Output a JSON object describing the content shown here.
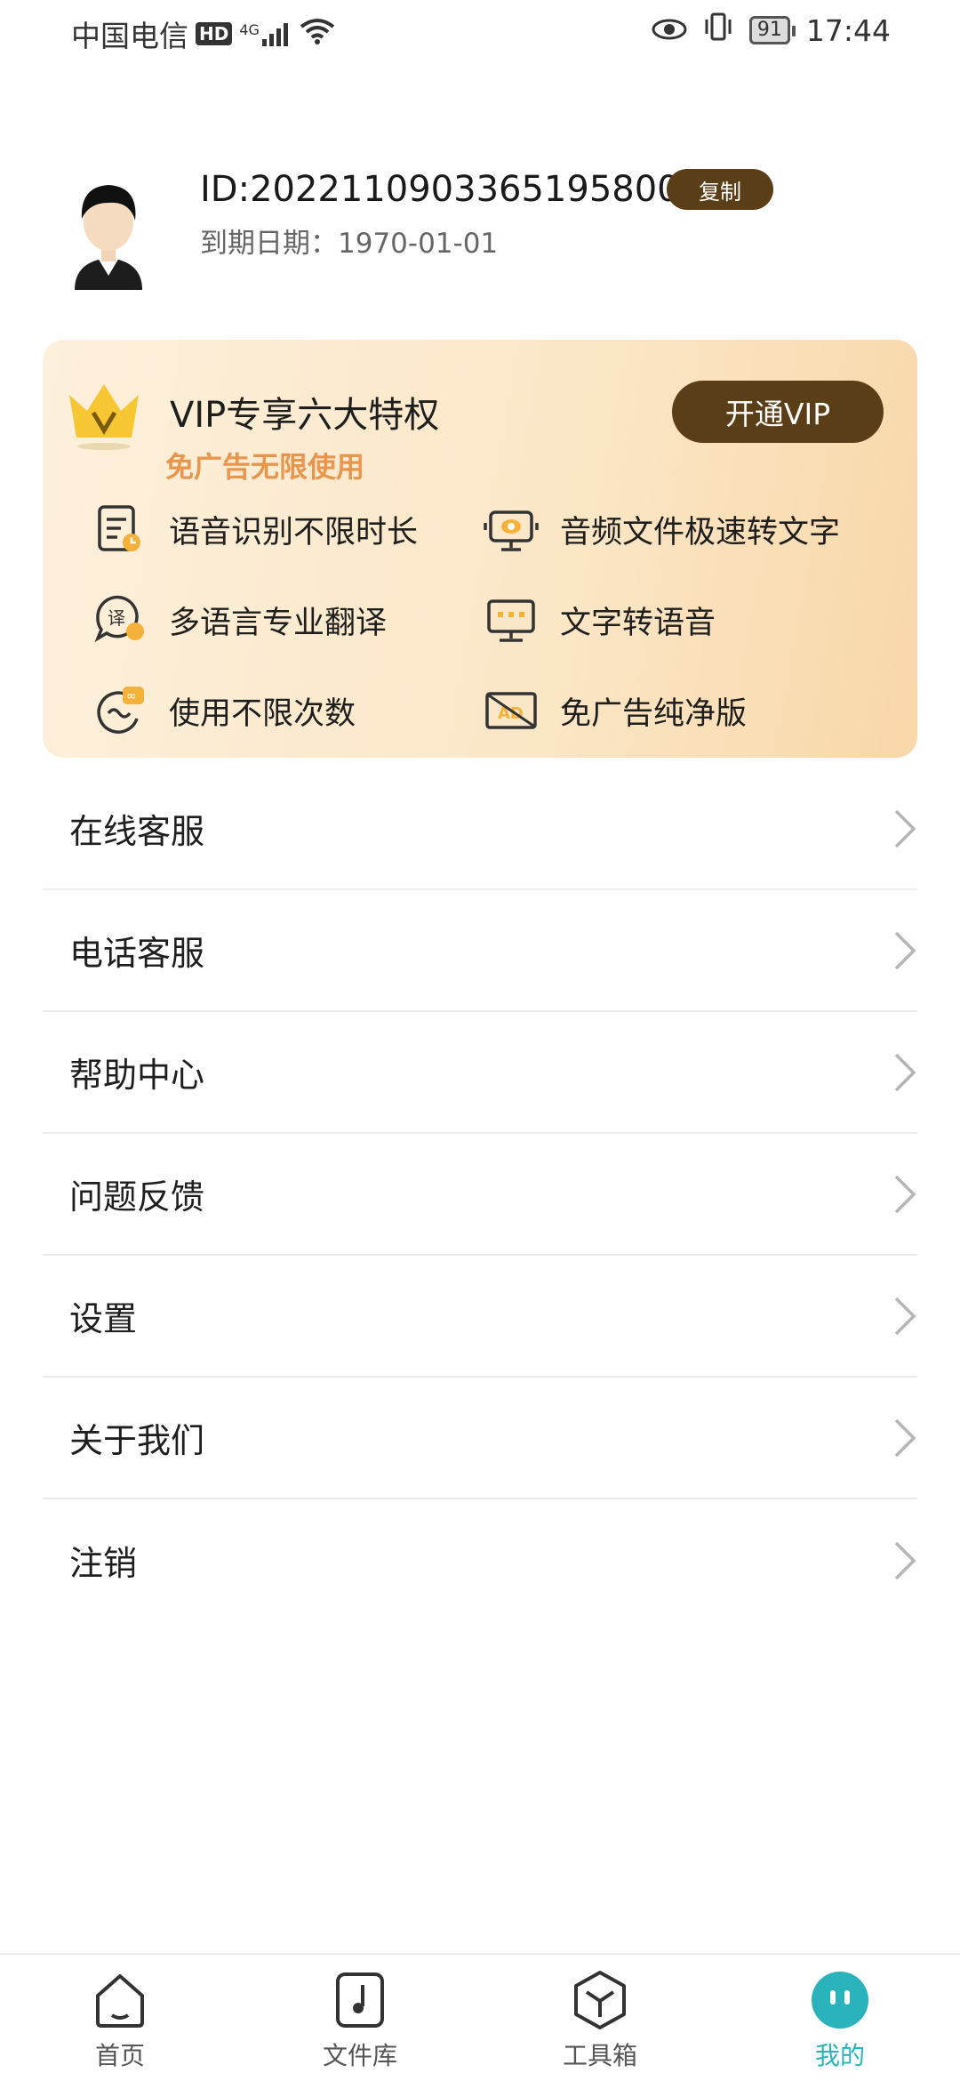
{
  "status_bar": {
    "carrier": "中国电信",
    "hd": "HD",
    "network": "4G",
    "battery": "91",
    "time": "17:44"
  },
  "profile": {
    "id": "ID:2022110903365195800",
    "copy_label": "复制",
    "expire": "到期日期：1970-01-01"
  },
  "vip": {
    "title": "VIP专享六大特权",
    "subtitle": "免广告无限使用",
    "button": "开通VIP",
    "features": [
      {
        "label": "语音识别不限时长",
        "icon": "voice-record-icon"
      },
      {
        "label": "音频文件极速转文字",
        "icon": "audio-to-text-icon"
      },
      {
        "label": "多语言专业翻译",
        "icon": "translate-icon"
      },
      {
        "label": "文字转语音",
        "icon": "text-to-speech-icon"
      },
      {
        "label": "使用不限次数",
        "icon": "unlimited-icon"
      },
      {
        "label": "免广告纯净版",
        "icon": "no-ads-icon"
      }
    ],
    "colors": {
      "accent": "#5a3e18",
      "subtitle": "#e9964c"
    }
  },
  "menu": [
    {
      "label": "在线客服"
    },
    {
      "label": "电话客服"
    },
    {
      "label": "帮助中心"
    },
    {
      "label": "问题反馈"
    },
    {
      "label": "设置"
    },
    {
      "label": "关于我们"
    },
    {
      "label": "注销"
    }
  ],
  "bottom_nav": [
    {
      "label": "首页",
      "icon": "home-icon"
    },
    {
      "label": "文件库",
      "icon": "music-file-icon"
    },
    {
      "label": "工具箱",
      "icon": "toolbox-icon"
    },
    {
      "label": "我的",
      "icon": "mine-icon",
      "active": true
    }
  ],
  "colors": {
    "active_tab": "#2bb3bb"
  }
}
